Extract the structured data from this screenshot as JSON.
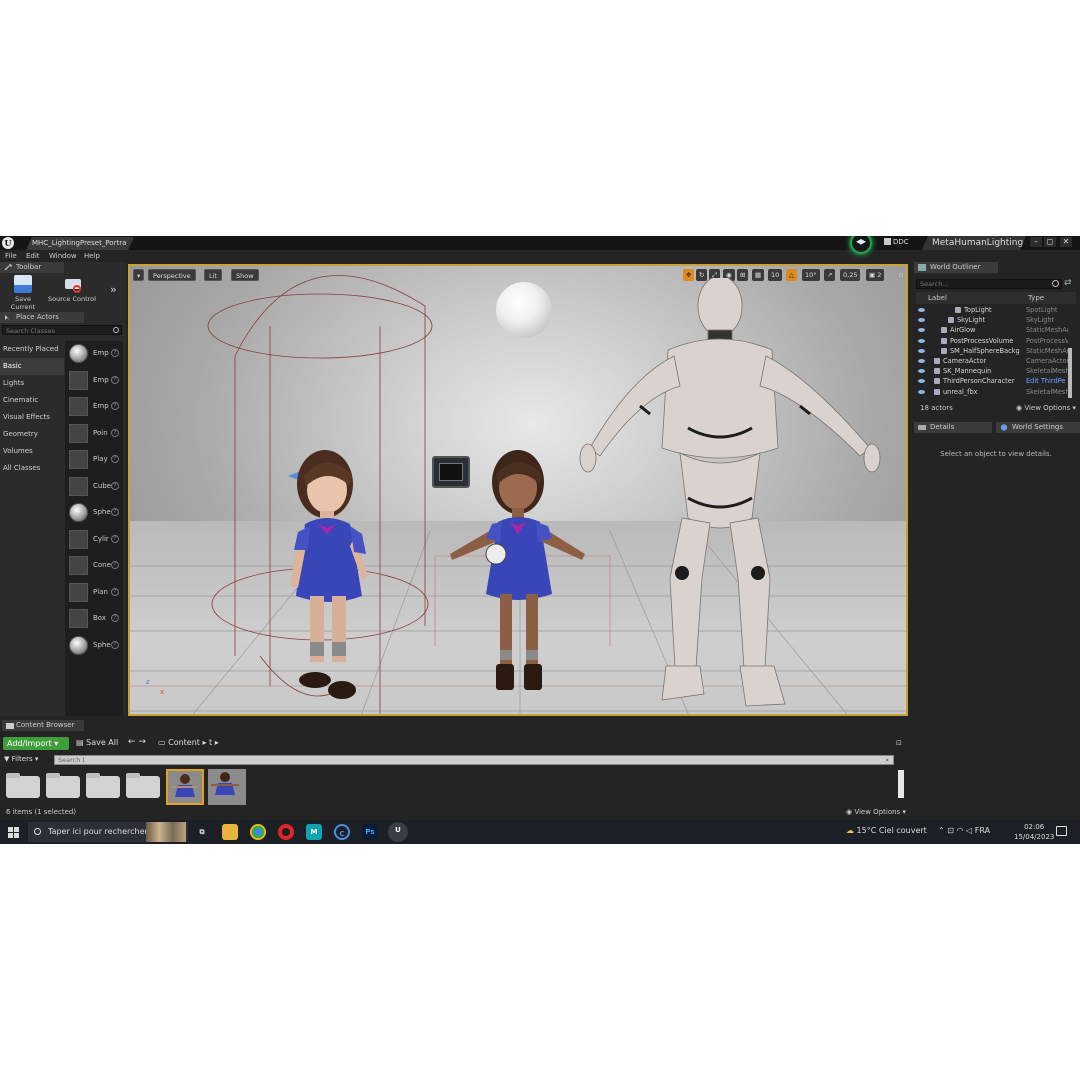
{
  "titlebar": {
    "tab": "MHC_LightingPreset_Portra",
    "ddc": "DDC",
    "project": "MetaHumanLighting",
    "controls": [
      "–",
      "◻",
      "✕"
    ]
  },
  "menu": [
    "File",
    "Edit",
    "Window",
    "Help"
  ],
  "toolbar": {
    "tab": "Toolbar",
    "save_current": "Save Current",
    "source_control": "Source Control",
    "more": "»"
  },
  "place_actors": {
    "tab": "Place Actors",
    "search_placeholder": "Search Classes",
    "categories": [
      "Recently Placed",
      "Basic",
      "Lights",
      "Cinematic",
      "Visual Effects",
      "Geometry",
      "Volumes",
      "All Classes"
    ],
    "selected_category": "Basic",
    "actors": [
      {
        "label": "Emp",
        "icon": "sphere-icon"
      },
      {
        "label": "Emp",
        "icon": "actor-icon"
      },
      {
        "label": "Emp",
        "icon": "pawn-icon"
      },
      {
        "label": "Poin",
        "icon": "light-bulb-icon"
      },
      {
        "label": "Play",
        "icon": "player-start-icon"
      },
      {
        "label": "Cube",
        "icon": "cube-icon"
      },
      {
        "label": "Sphe",
        "icon": "sphere-icon"
      },
      {
        "label": "Cylir",
        "icon": "cylinder-icon"
      },
      {
        "label": "Cone",
        "icon": "cone-icon"
      },
      {
        "label": "Plan",
        "icon": "plane-icon"
      },
      {
        "label": "Box",
        "icon": "box-trigger-icon"
      },
      {
        "label": "Sphe",
        "icon": "sphere-trigger-icon"
      }
    ],
    "help": "?"
  },
  "viewport": {
    "perspective": "Perspective",
    "lit": "Lit",
    "show": "Show",
    "grid_snap": "10",
    "rot_snap": "10°",
    "scale_snap": "0,25",
    "camera_speed": "2",
    "axis_z": "z",
    "axis_x": "x"
  },
  "world_outliner": {
    "tab": "World Outliner",
    "search_placeholder": "Search...",
    "col_label": "Label",
    "col_type": "Type",
    "rows": [
      {
        "label": "TopLight",
        "type": "SpotLight",
        "indent": 3
      },
      {
        "label": "SkyLight",
        "type": "SkyLight",
        "indent": 2
      },
      {
        "label": "AirGlow",
        "type": "StaticMeshAc",
        "indent": 1
      },
      {
        "label": "PostProcessVolume",
        "type": "PostProcessV",
        "indent": 1
      },
      {
        "label": "SM_HalfSphereBackg",
        "type": "StaticMeshAc",
        "indent": 1
      },
      {
        "label": "CameraActor",
        "type": "CameraActor",
        "indent": 0
      },
      {
        "label": "SK_Mannequin",
        "type": "SkeletalMesh",
        "indent": 0
      },
      {
        "label": "ThirdPersonCharacter",
        "type": "Edit ThirdPe",
        "indent": 0,
        "link": true
      },
      {
        "label": "unreal_fbx",
        "type": "SkeletalMesh",
        "indent": 0
      }
    ],
    "count": "18 actors",
    "view_options": "View Options"
  },
  "details": {
    "tab_details": "Details",
    "tab_world": "World Settings",
    "message": "Select an object to view details."
  },
  "content_browser": {
    "tab": "Content Browser",
    "add_import": "Add/Import",
    "save_all": "Save All",
    "path_root": "Content",
    "path_child": "t",
    "filters": "Filters",
    "search_placeholder": "Search t",
    "count": "6 items (1 selected)",
    "view_options": "View Options"
  },
  "taskbar": {
    "search": "Taper ici pour rechercher",
    "apps": [
      "Ps"
    ],
    "weather": "15°C  Ciel couvert",
    "lang": "FRA",
    "time": "02:06",
    "date": "15/04/2023"
  },
  "colors": {
    "selection": "#e0a11b",
    "add_import": "#3f9e3a",
    "link": "#6ea4ff"
  }
}
